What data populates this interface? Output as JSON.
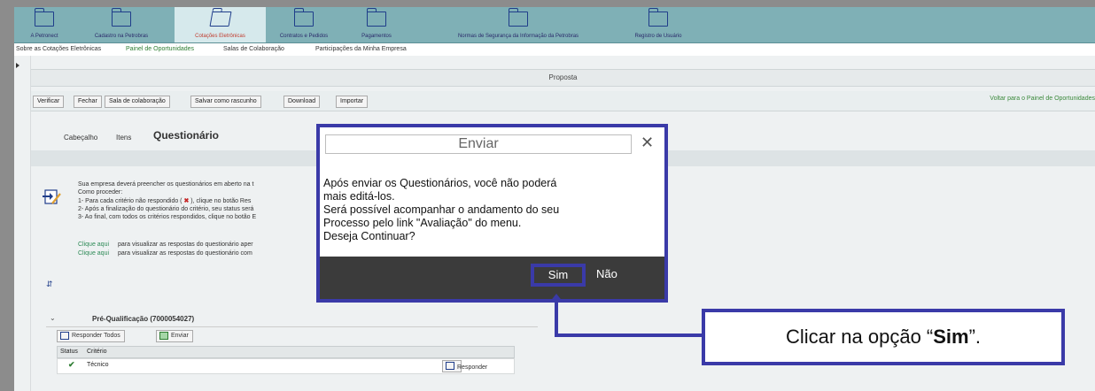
{
  "nav": {
    "tabs": [
      {
        "label": "A Petronect"
      },
      {
        "label": "Cadastro na Petrobras"
      },
      {
        "label": "Cotações Eletrônicas"
      },
      {
        "label": "Contratos e Pedidos"
      },
      {
        "label": "Pagamentos"
      },
      {
        "label": "Normas de Segurança da Informação da Petrobras"
      },
      {
        "label": "Registro de Usuário"
      }
    ],
    "active_tab": "Cotações Eletrônicas"
  },
  "subnav": {
    "items": [
      {
        "label": "Sobre as Cotações Eletrônicas"
      },
      {
        "label": "Painel de Oportunidades"
      },
      {
        "label": "Salas de Colaboração"
      },
      {
        "label": "Participações da Minha Empresa"
      }
    ]
  },
  "page": {
    "title": "Proposta"
  },
  "toolbar": {
    "buttons": [
      {
        "label": "Verificar"
      },
      {
        "label": "Fechar"
      },
      {
        "label": "Sala de colaboração"
      },
      {
        "label": "Salvar como rascunho"
      },
      {
        "label": "Download"
      },
      {
        "label": "Importar"
      }
    ],
    "back_link": "Voltar para o Painel de Oportunidades"
  },
  "tabs": {
    "cabecalho": "Cabeçalho",
    "itens": "Itens",
    "questionario": "Questionário"
  },
  "info": {
    "line1": "Sua empresa deverá preencher os questionários em aberto na t",
    "line2": "Como proceder:",
    "line3a": "1- Para cada critério não respondido ( ",
    "line3x": "✖",
    "line3b": " ), clique no botão Res",
    "line4": "2- Após a finalização do questionário do critério, seu status será",
    "line5": "3- Ao final, com todos os critérios respondidos, clique no botão E",
    "clique1_link": "Clique aqui",
    "clique1_text": "para visualizar as respostas do questionário aper",
    "clique2_link": "Clique aqui",
    "clique2_text": "para visualizar as respostas do questionário com"
  },
  "panel": {
    "title": "Pré-Qualificação (7000054027)",
    "responder_todos": "Responder Todos",
    "enviar": "Enviar",
    "col_status": "Status",
    "col_criterio": "Critério",
    "row_criterio": "Técnico",
    "row_action": "Responder"
  },
  "modal": {
    "title": "Enviar",
    "body": [
      "Após enviar os Questionários, você não poderá",
      "mais editá-los.",
      "Será possível acompanhar o andamento do seu",
      "Processo pelo link \"Avaliação\" do menu.",
      "Deseja Continuar?"
    ],
    "yes": "Sim",
    "no": "Não"
  },
  "callout": {
    "prefix": "Clicar na opção “",
    "bold": "Sim",
    "suffix": "”."
  },
  "colors": {
    "highlight": "#3a3aa8",
    "nav_bg": "#7fb0b6",
    "modal_footer": "#3b3b3b"
  }
}
